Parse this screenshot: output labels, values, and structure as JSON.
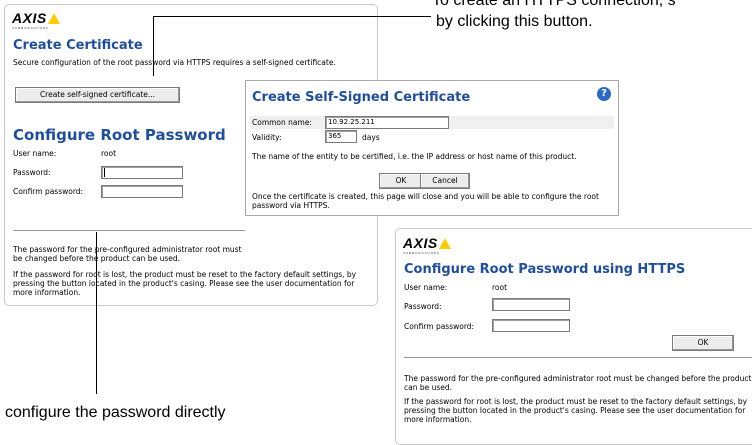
{
  "callouts": {
    "top_right_line1": "To create an HTTPS connection, s",
    "top_right_line2": "by clicking this button.",
    "bottom_left": "configure the password directly"
  },
  "panel1": {
    "logo": "AXIS",
    "logo_sub": "COMMUNICATIONS",
    "create_cert_title": "Create Certificate",
    "create_cert_desc": "Secure configuration of the root password via HTTPS requires a self-signed certificate.",
    "create_button": "Create self-signed certificate...",
    "root_pw_title": "Configure Root Password",
    "username_label": "User name:",
    "username_value": "root",
    "password_label": "Password:",
    "confirm_label": "Confirm password:",
    "note1": "The password for the pre-configured administrator root must be changed before the product can be used.",
    "note2": "If the password for root is lost, the product must be reset to the factory default settings, by pressing the button located in the product's casing. Please see the user documentation for more information."
  },
  "panel2": {
    "title": "Create Self-Signed Certificate",
    "help": "?",
    "common_name_label": "Common name:",
    "common_name_value": "10.92.25.211",
    "validity_label": "Validity:",
    "validity_value": "365",
    "validity_unit": "days",
    "footnote": "The name of the entity to be certified, i.e. the IP address or host name of this product.",
    "ok": "OK",
    "cancel": "Cancel",
    "info": "Once the certificate is created, this page will close and you will be able to configure the root password via HTTPS."
  },
  "panel3": {
    "logo": "AXIS",
    "logo_sub": "COMMUNICATIONS",
    "title": "Configure Root Password using HTTPS",
    "username_label": "User name:",
    "username_value": "root",
    "password_label": "Password:",
    "confirm_label": "Confirm password:",
    "ok": "OK",
    "note1": "The password for the pre-configured administrator root must be changed before the product can be used.",
    "note2": "If the password for root is lost, the product must be reset to the factory default settings, by pressing the button located in the product's casing. Please see the user documentation for more information."
  }
}
